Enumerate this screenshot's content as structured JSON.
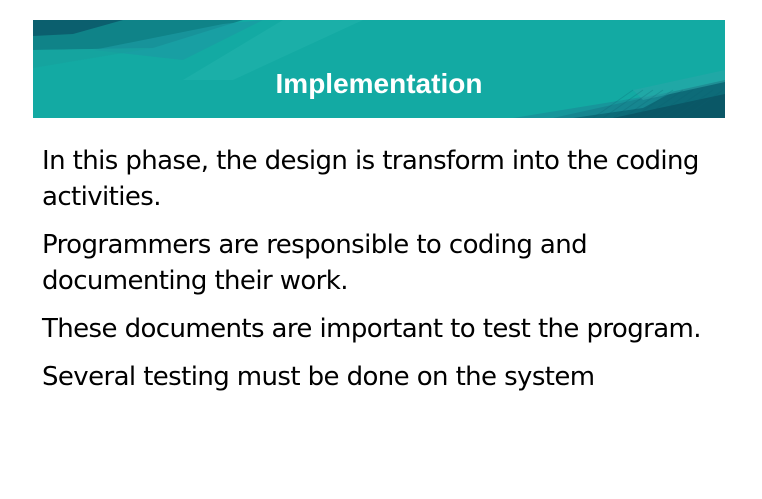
{
  "slide": {
    "title": "Implementation",
    "paragraphs": [
      "In this phase, the design is transform into the coding activities.",
      "Programmers are responsible to coding and documenting their work.",
      "These documents are important to test the program.",
      "Several testing must be done on the system"
    ]
  },
  "colors": {
    "banner_base": "#13aaa3",
    "banner_dark": "#0e6f7c",
    "title_text": "#ffffff",
    "body_text": "#000000"
  }
}
